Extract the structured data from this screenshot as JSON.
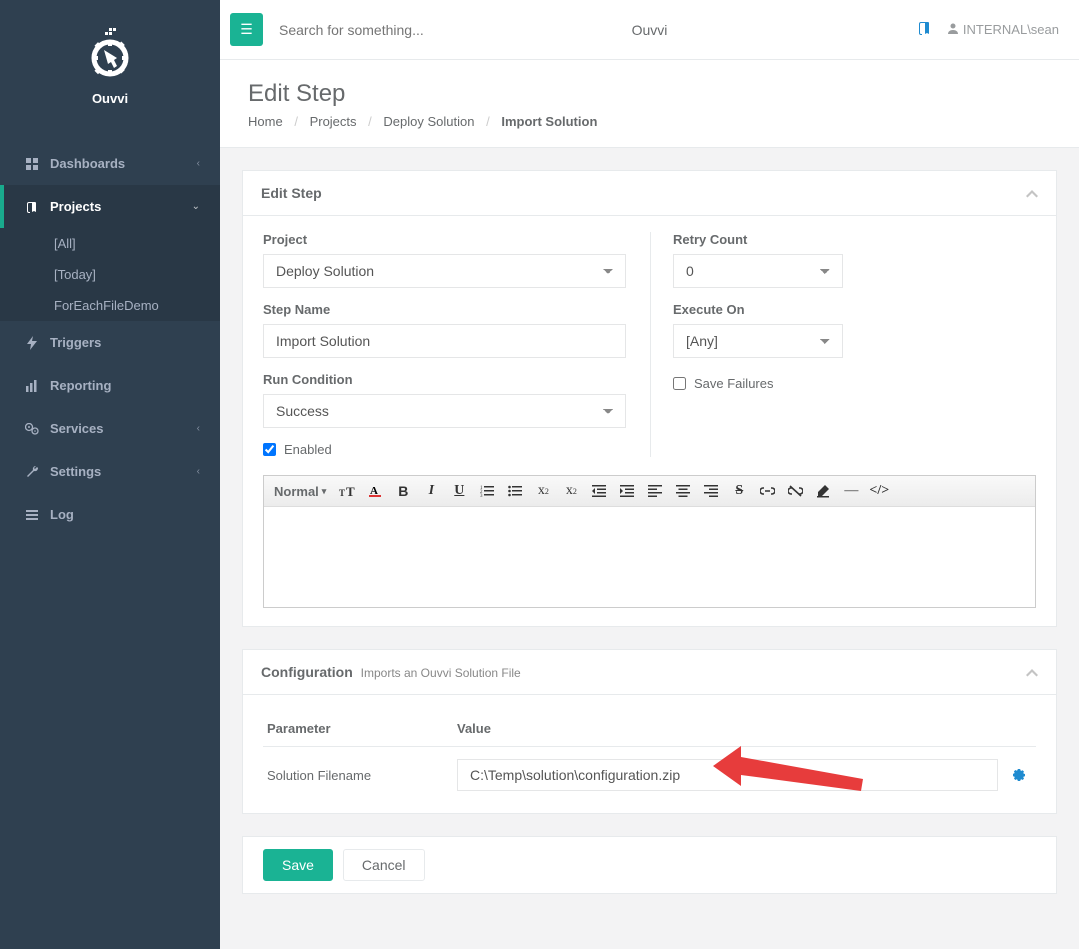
{
  "app_name": "Ouvvi",
  "topbar": {
    "search_placeholder": "Search for something...",
    "center_label": "Ouvvi",
    "user_label": "INTERNAL\\sean"
  },
  "sidebar": {
    "items": [
      {
        "label": "Dashboards",
        "icon": "grid"
      },
      {
        "label": "Projects",
        "icon": "book",
        "active": true,
        "children": [
          "[All]",
          "[Today]",
          "ForEachFileDemo"
        ]
      },
      {
        "label": "Triggers",
        "icon": "bolt"
      },
      {
        "label": "Reporting",
        "icon": "chart"
      },
      {
        "label": "Services",
        "icon": "cogs"
      },
      {
        "label": "Settings",
        "icon": "wrench"
      },
      {
        "label": "Log",
        "icon": "list"
      }
    ]
  },
  "page": {
    "title": "Edit Step",
    "breadcrumb": [
      "Home",
      "Projects",
      "Deploy Solution",
      "Import Solution"
    ]
  },
  "editStep": {
    "panel_title": "Edit Step",
    "left": {
      "project_label": "Project",
      "project_value": "Deploy Solution",
      "step_label": "Step Name",
      "step_value": "Import Solution",
      "run_label": "Run Condition",
      "run_value": "Success",
      "enabled_label": "Enabled",
      "enabled_checked": true
    },
    "right": {
      "retry_label": "Retry Count",
      "retry_value": "0",
      "exec_label": "Execute On",
      "exec_value": "[Any]",
      "savefail_label": "Save Failures",
      "savefail_checked": false
    },
    "editor": {
      "format_label": "Normal"
    }
  },
  "config": {
    "panel_title": "Configuration",
    "panel_subtitle": "Imports an Ouvvi Solution File",
    "header_param": "Parameter",
    "header_value": "Value",
    "rows": [
      {
        "param": "Solution Filename",
        "value": "C:\\Temp\\solution\\configuration.zip"
      }
    ]
  },
  "actions": {
    "save": "Save",
    "cancel": "Cancel"
  }
}
